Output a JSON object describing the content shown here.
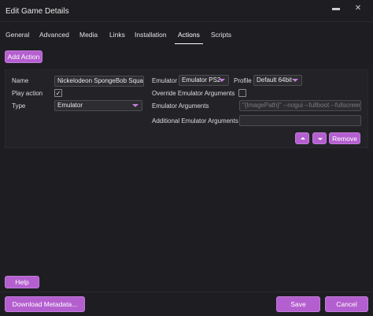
{
  "window": {
    "title": "Edit Game Details",
    "minimize_glyph": "▬",
    "close_glyph": "✕"
  },
  "tabs": [
    {
      "label": "General"
    },
    {
      "label": "Advanced"
    },
    {
      "label": "Media"
    },
    {
      "label": "Links"
    },
    {
      "label": "Installation"
    },
    {
      "label": "Actions",
      "active": true
    },
    {
      "label": "Scripts"
    }
  ],
  "actions": {
    "add_action_label": "Add Action"
  },
  "action_editor": {
    "name_label": "Name",
    "name_value": "Nickelodeon SpongeBob Squarepants",
    "play_action_label": "Play action",
    "play_action_checked": true,
    "type_label": "Type",
    "type_value": "Emulator",
    "emulator_label": "Emulator",
    "emulator_value": "Emulator PS2",
    "profile_label": "Profile",
    "profile_value": "Default 64bit",
    "override_label": "Override Emulator Arguments",
    "override_checked": false,
    "emulator_args_label": "Emulator Arguments",
    "emulator_args_value": "\"{ImagePath}\" --nogui --fullboot --fullscreen",
    "additional_args_label": "Additional Emulator Arguments",
    "additional_args_value": "",
    "remove_label": "Remove",
    "check_glyph": "✓"
  },
  "footer": {
    "help_label": "Help",
    "download_metadata_label": "Download Metadata...",
    "save_label": "Save",
    "cancel_label": "Cancel"
  },
  "colors": {
    "accent": "#b45fcf",
    "background": "#1e1e22"
  }
}
